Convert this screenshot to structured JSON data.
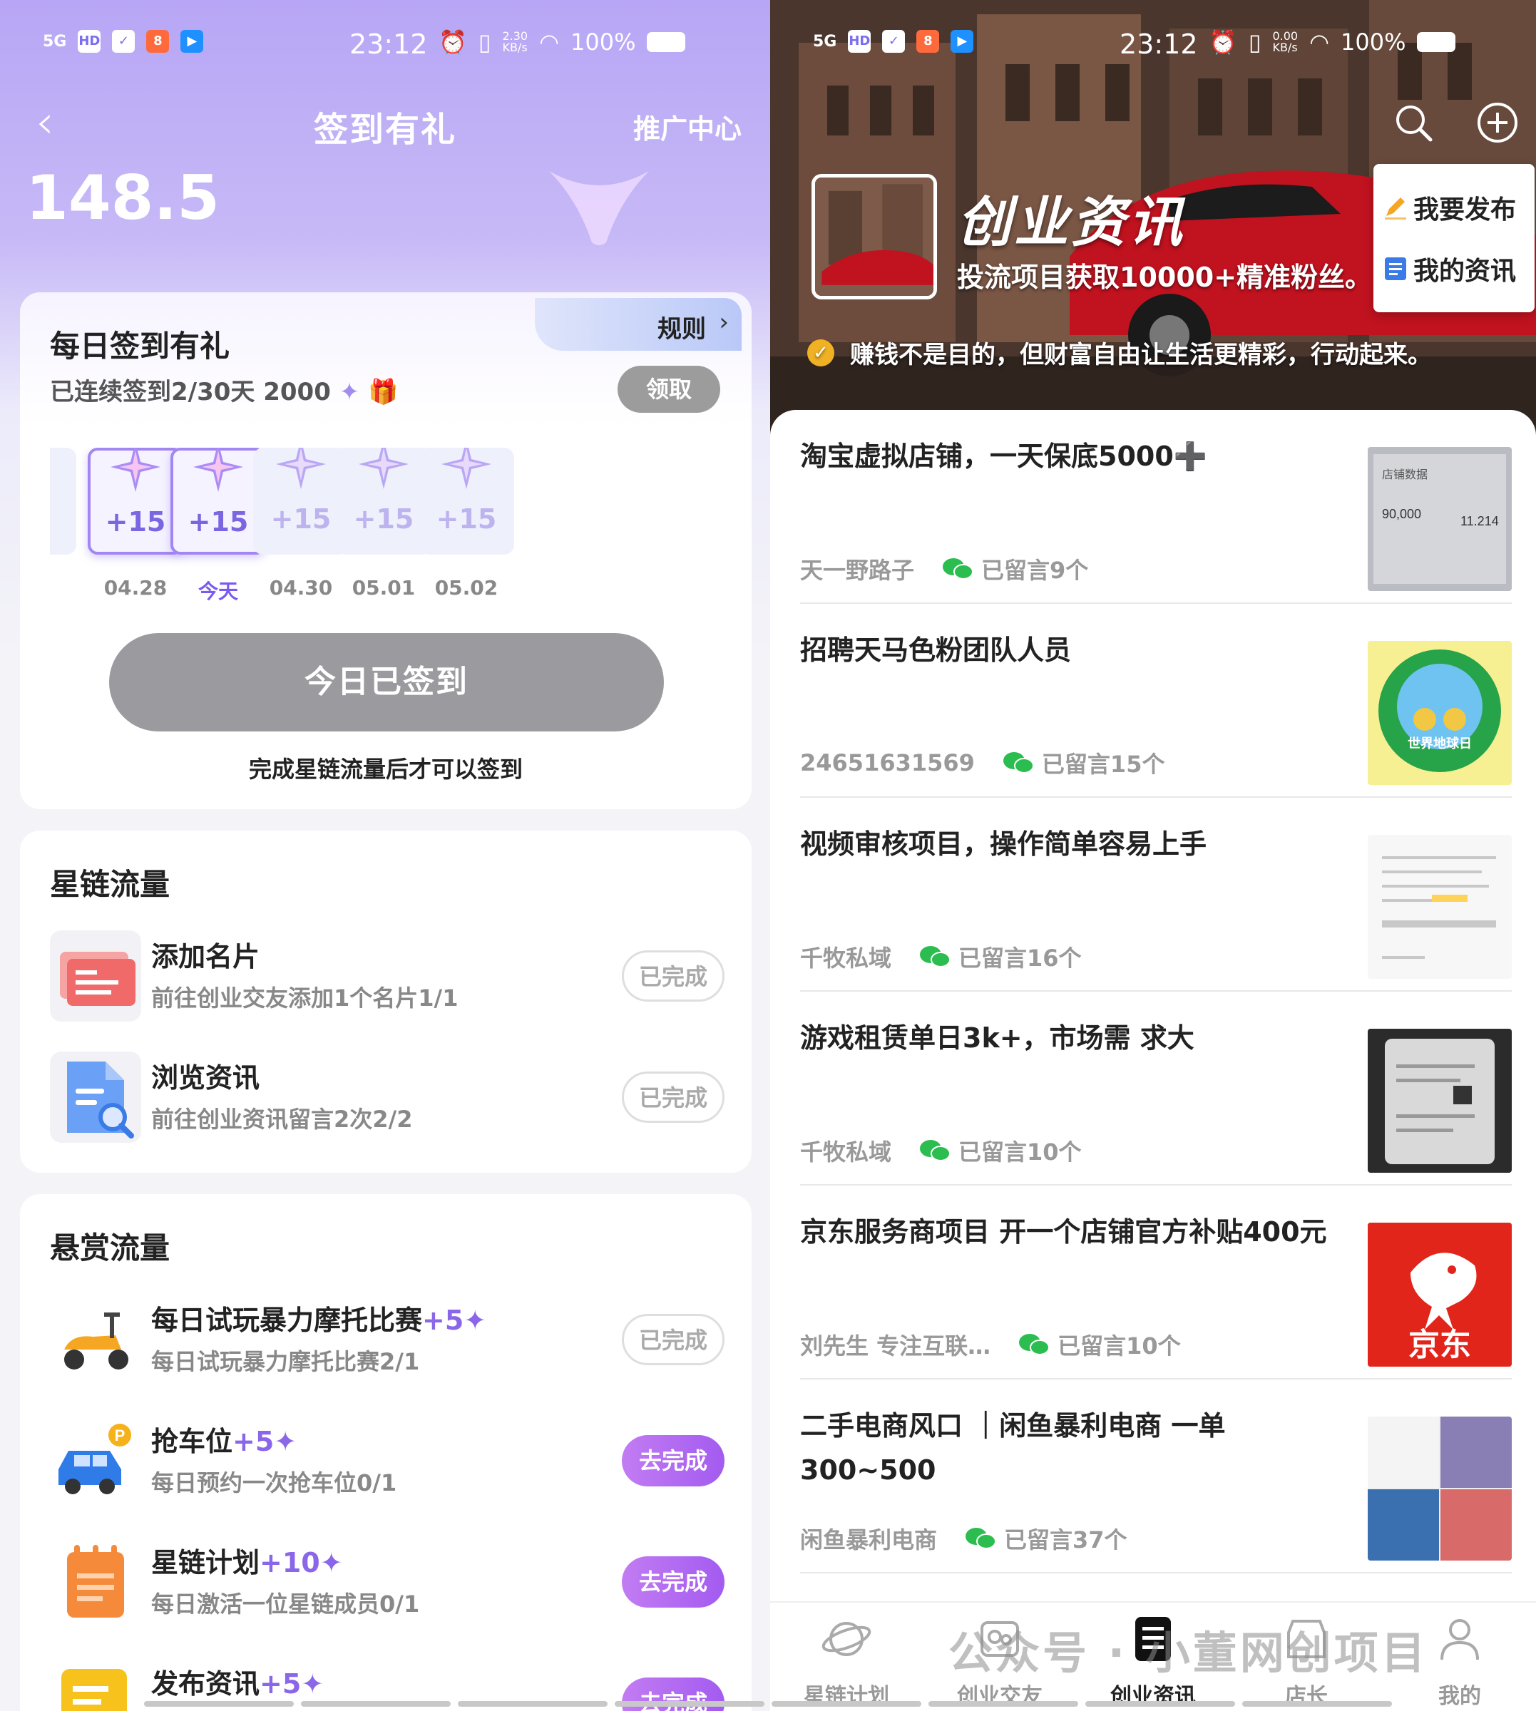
{
  "left": {
    "status": {
      "network": "5G",
      "hd": "HD",
      "time": "23:12",
      "speed": "2.30\nKB/s",
      "battery": "100%"
    },
    "nav": {
      "back_glyph": "‹",
      "title": "签到有礼",
      "right_link": "推广中心"
    },
    "points": "148.5",
    "signin": {
      "rule_label": "规则",
      "heading": "每日签到有礼",
      "streak": "已连续签到2/30天 2000",
      "claim_button": "领取",
      "days": [
        {
          "amount": "+15",
          "date": "04.28",
          "state": "done"
        },
        {
          "amount": "+15",
          "date": "今天",
          "state": "today"
        },
        {
          "amount": "+15",
          "date": "04.30",
          "state": "future"
        },
        {
          "amount": "+15",
          "date": "05.01",
          "state": "future"
        },
        {
          "amount": "+15",
          "date": "05.02",
          "state": "future"
        }
      ],
      "signed_button": "今日已签到",
      "note": "完成星链流量后才可以签到"
    },
    "xinglian": {
      "title": "星链流量",
      "tasks": [
        {
          "name": "添加名片",
          "bonus": "",
          "desc": "前往创业交友添加1个名片1/1",
          "button": "已完成",
          "icon": "business-card-icon"
        },
        {
          "name": "浏览资讯",
          "bonus": "",
          "desc": "前往创业资讯留言2次2/2",
          "button": "已完成",
          "icon": "document-search-icon"
        }
      ]
    },
    "xuanshang": {
      "title": "悬赏流量",
      "tasks": [
        {
          "name": "每日试玩暴力摩托比赛",
          "bonus": "+5",
          "desc": "每日试玩暴力摩托比赛2/1",
          "button": "已完成",
          "icon": "scooter-icon"
        },
        {
          "name": "抢车位",
          "bonus": "+5",
          "desc": "每日预约一次抢车位0/1",
          "button": "去完成",
          "icon": "parking-car-icon"
        },
        {
          "name": "星链计划",
          "bonus": "+10",
          "desc": "每日激活一位星链成员0/1",
          "button": "去完成",
          "icon": "notepad-icon"
        },
        {
          "name": "发布资讯",
          "bonus": "+5",
          "desc": "",
          "button": "去完成",
          "icon": "publish-icon"
        }
      ]
    }
  },
  "right": {
    "status": {
      "network": "5G",
      "hd": "HD",
      "time": "23:12",
      "speed": "0.00\nKB/s",
      "battery": "100%"
    },
    "hero": {
      "title": "创业资讯",
      "subtitle": "投流项目获取10000+精准粉丝。",
      "slogan": "赚钱不是目的，但财富自由让生活更精彩，行动起来。"
    },
    "popup": {
      "publish": "我要发布",
      "my_news": "我的资讯"
    },
    "news": [
      {
        "title": "淘宝虚拟店铺，一天保底5000➕",
        "author": "天一野路子",
        "comments": "已留言9个"
      },
      {
        "title": "招聘天马色粉团队人员",
        "author": "24651631569",
        "comments": "已留言15个"
      },
      {
        "title": "视频审核项目，操作简单容易上手",
        "author": "千牧私域",
        "comments": "已留言16个"
      },
      {
        "title": "游戏租赁单日3k+，市场需 求大",
        "author": "千牧私域",
        "comments": "已留言10个"
      },
      {
        "title": "京东服务商项目 开一个店铺官方补贴400元",
        "author": "刘先生 专注互联…",
        "comments": "已留言10个"
      },
      {
        "title": "二手电商风口 ｜闲鱼暴利电商 一单300~500",
        "author": "闲鱼暴利电商",
        "comments": "已留言37个"
      }
    ],
    "thumb_text": {
      "shop_title": "店铺数据",
      "shop_value_1": "90,000",
      "shop_value_2": "11.214",
      "jd": "京东",
      "earth": "世界地球日"
    },
    "tabs": [
      {
        "label": "星链计划",
        "icon": "planet-icon",
        "active": false
      },
      {
        "label": "创业交友",
        "icon": "friends-icon",
        "active": false
      },
      {
        "label": "创业资讯",
        "icon": "news-icon",
        "active": true
      },
      {
        "label": "店长",
        "icon": "store-icon",
        "active": false
      },
      {
        "label": "我的",
        "icon": "user-icon",
        "active": false
      }
    ],
    "watermark": "公众号 · 小董网创项目"
  },
  "colors": {
    "purple_accent": "#8a66e8",
    "go_button": "#a35bf0",
    "wechat_green": "#2bbd4f",
    "jd_red": "#e1251b"
  }
}
